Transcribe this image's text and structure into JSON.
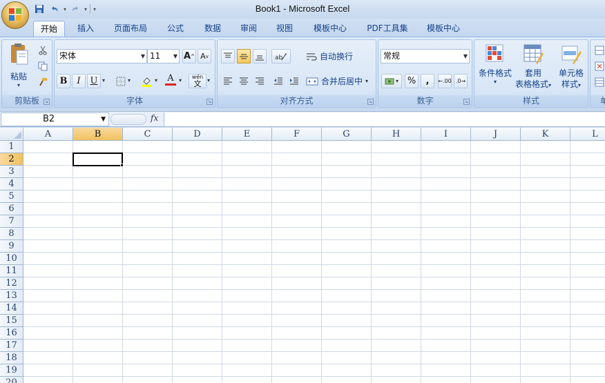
{
  "window": {
    "title": "Book1 - Microsoft Excel"
  },
  "quick_access": {
    "items": [
      {
        "name": "save-icon",
        "glyph": "💾"
      },
      {
        "name": "undo-icon",
        "glyph": "↶"
      },
      {
        "name": "redo-icon",
        "glyph": "↷"
      }
    ],
    "customize_glyph": "▾"
  },
  "ribbon_tabs": [
    "开始",
    "插入",
    "页面布局",
    "公式",
    "数据",
    "审阅",
    "视图",
    "模板中心",
    "PDF工具集",
    "模板中心"
  ],
  "active_tab": "开始",
  "groups": {
    "clipboard": {
      "label": "剪贴板",
      "paste": "粘贴"
    },
    "font": {
      "label": "字体",
      "font_name": "宋体",
      "font_size": "11",
      "bold": "B",
      "italic": "I",
      "underline": "U",
      "grow": "A",
      "shrink": "A",
      "font_color_glyph": "A",
      "phonetic_glyph": "wén"
    },
    "alignment": {
      "label": "对齐方式",
      "wrap_text": "自动换行",
      "merge_center": "合并后居中"
    },
    "number": {
      "label": "数字",
      "format": "常规",
      "percent": "%",
      "comma": ",",
      "inc_decimal": ".00",
      "dec_decimal": ".0"
    },
    "styles": {
      "label": "样式",
      "conditional": "条件格式",
      "table_format_1": "套用",
      "table_format_2": "表格格式",
      "cell_styles_1": "单元格",
      "cell_styles_2": "样式"
    },
    "cells": {
      "label": "单"
    }
  },
  "formula_bar": {
    "name_box": "B2",
    "fx": "fx",
    "formula": ""
  },
  "sheet": {
    "columns": [
      "A",
      "B",
      "C",
      "D",
      "E",
      "F",
      "G",
      "H",
      "I",
      "J",
      "K",
      "L"
    ],
    "rows": [
      "1",
      "2",
      "3",
      "4",
      "5",
      "6",
      "7",
      "8",
      "9",
      "10",
      "11",
      "12",
      "13",
      "14",
      "15",
      "16",
      "17",
      "18",
      "19",
      "20"
    ],
    "selected_column": "B",
    "selected_row": "2"
  },
  "colors": {
    "accent": "#15428b",
    "selection": "#f1c15f",
    "grid": "#d0d7e5"
  }
}
